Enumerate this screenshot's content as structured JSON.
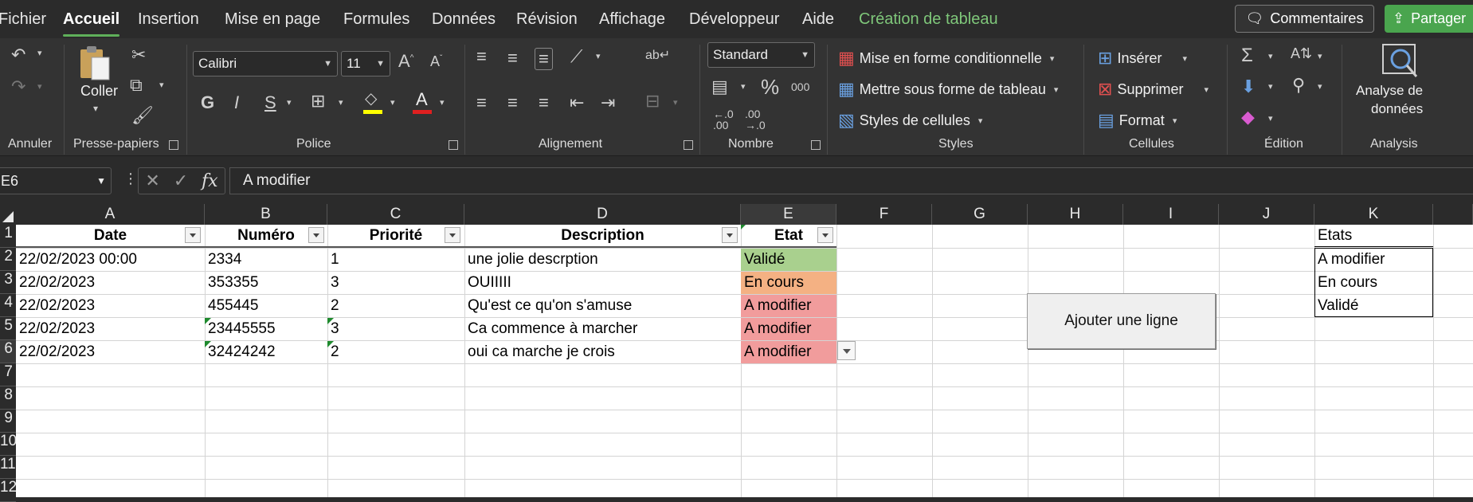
{
  "menu": {
    "tabs": [
      "Fichier",
      "Accueil",
      "Insertion",
      "Mise en page",
      "Formules",
      "Données",
      "Révision",
      "Affichage",
      "Développeur",
      "Aide",
      "Création de tableau"
    ],
    "comments_label": "Commentaires",
    "share_label": "Partager"
  },
  "ribbon": {
    "groups": {
      "annuler": "Annuler",
      "presse_papiers": "Presse-papiers",
      "police": "Police",
      "alignement": "Alignement",
      "nombre": "Nombre",
      "styles": "Styles",
      "cellules": "Cellules",
      "edition": "Édition",
      "analysis": "Analysis"
    },
    "paste_label": "Coller",
    "font_name": "Calibri",
    "font_size": "11",
    "number_format": "Standard",
    "conditional_format": "Mise en forme conditionnelle",
    "format_as_table": "Mettre sous forme de tableau",
    "cell_styles": "Styles de cellules",
    "insert": "Insérer",
    "delete": "Supprimer",
    "format": "Format",
    "analyze_line1": "Analyse de",
    "analyze_line2": "données",
    "bold": "G",
    "italic": "I",
    "underline": "S",
    "thousands": "000"
  },
  "formula_bar": {
    "cell_ref": "E6",
    "formula": "A modifier"
  },
  "sheet": {
    "columns": [
      "A",
      "B",
      "C",
      "D",
      "E",
      "F",
      "G",
      "H",
      "I",
      "J",
      "K"
    ],
    "rows": [
      "1",
      "2",
      "3",
      "4",
      "5",
      "6",
      "7",
      "8",
      "9",
      "10",
      "11",
      "12"
    ],
    "headers": {
      "date": "Date",
      "numero": "Numéro",
      "priorite": "Priorité",
      "description": "Description",
      "etat": "Etat"
    },
    "data": [
      {
        "date": "22/02/2023 00:00",
        "numero": "2334",
        "priorite": "1",
        "description": "une jolie descrption",
        "etat": "Validé"
      },
      {
        "date": "22/02/2023",
        "numero": "353355",
        "priorite": "3",
        "description": "OUIIIII",
        "etat": "En cours"
      },
      {
        "date": "22/02/2023",
        "numero": "455445",
        "priorite": "2",
        "description": "Qu'est ce qu'on s'amuse",
        "etat": "A modifier"
      },
      {
        "date": "22/02/2023",
        "numero": "23445555",
        "priorite": "3",
        "description": "Ca commence à marcher",
        "etat": "A modifier"
      },
      {
        "date": "22/02/2023",
        "numero": "32424242",
        "priorite": "2",
        "description": "oui ca marche je crois",
        "etat": "A modifier"
      }
    ],
    "states_header": "Etats",
    "states": [
      "A modifier",
      "En cours",
      "Validé"
    ],
    "add_row_button": "Ajouter une ligne"
  },
  "colors": {
    "valide": "#a9d08e",
    "en_cours": "#f4b183",
    "a_modifier": "#f19c9c",
    "accent": "#5fb05a"
  }
}
